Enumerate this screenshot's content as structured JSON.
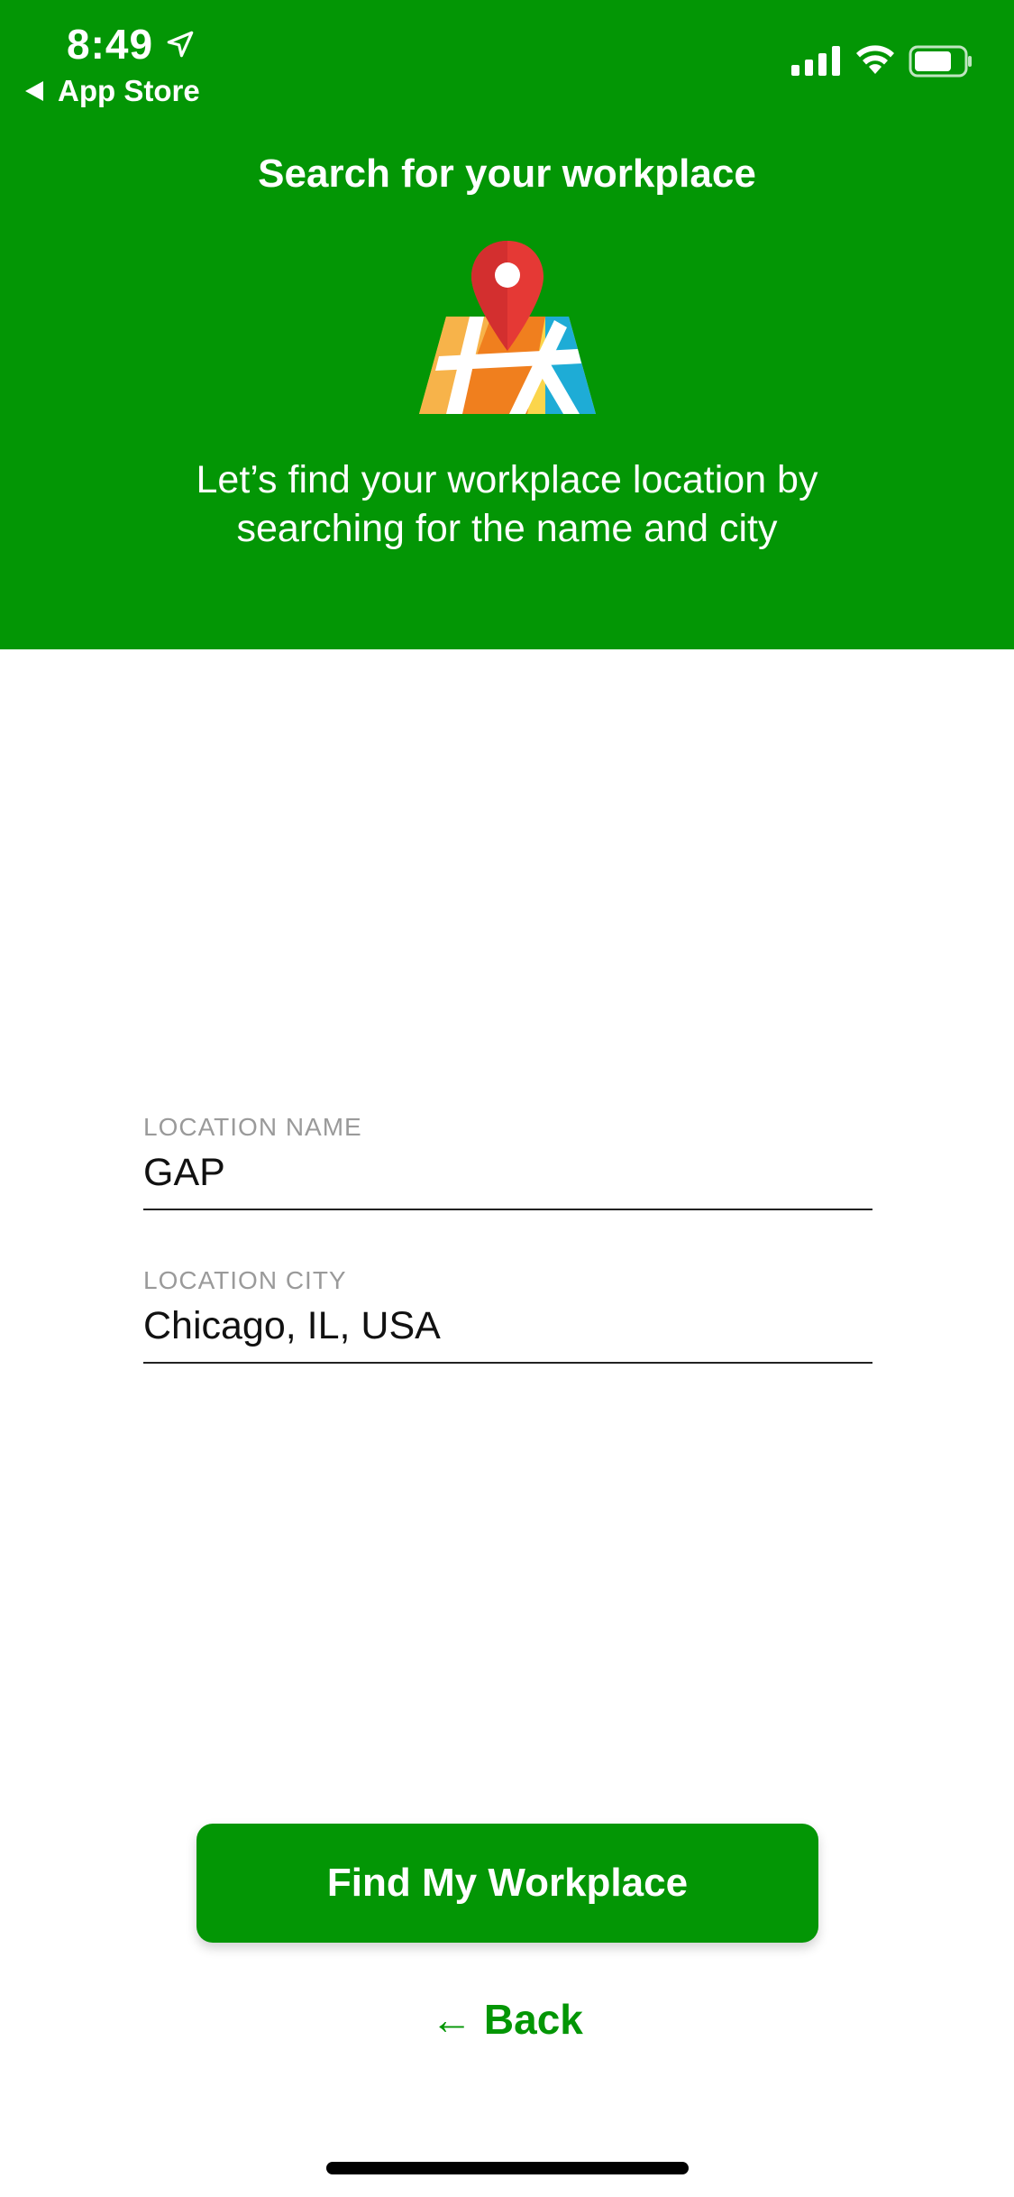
{
  "status_bar": {
    "time": "8:49",
    "back_app": "App Store",
    "icons": [
      "location-arrow-icon",
      "signal-icon",
      "wifi-icon",
      "battery-icon"
    ]
  },
  "header": {
    "title": "Search for your workplace",
    "subtitle_line1": "Let’s find your workplace location by",
    "subtitle_line2": "searching for the name and city",
    "icon": "map-pin-icon"
  },
  "form": {
    "location_name": {
      "label": "LOCATION NAME",
      "value": "GAP"
    },
    "location_city": {
      "label": "LOCATION CITY",
      "value": "Chicago, IL, USA"
    }
  },
  "actions": {
    "find_label": "Find My Workplace",
    "back_label": "← Back"
  },
  "colors": {
    "brand_green": "#039605",
    "text_dark": "#111111",
    "label_gray": "#9a9a9a"
  }
}
